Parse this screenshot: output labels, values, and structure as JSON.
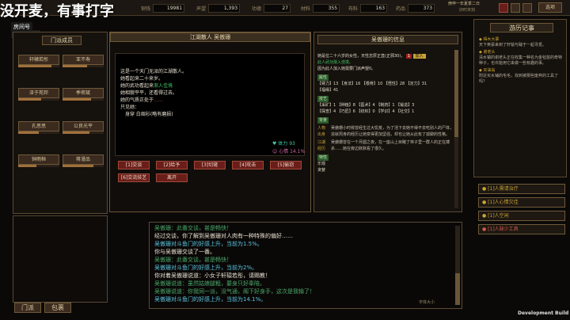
{
  "overlay": {
    "title": "没开麦，有事打字",
    "id_label": "房间号",
    "id_value": "1570959"
  },
  "topbar": {
    "stats": [
      {
        "label": "铜钱",
        "value": "19981"
      },
      {
        "label": "声望",
        "value": "1,393"
      },
      {
        "label": "功德",
        "value": "27"
      },
      {
        "label": "材料",
        "value": "355"
      },
      {
        "label": "布料",
        "value": "163"
      },
      {
        "label": "药品",
        "value": "373"
      }
    ],
    "date": "庚申一年夏季二日",
    "sub": "卯时末刻",
    "menu_label": "选项"
  },
  "left": {
    "header": "门派成员",
    "members": [
      {
        "name": "轩辕若彤",
        "bar": "80%"
      },
      {
        "name": "亚不寿",
        "bar": "60%"
      },
      {
        "name": "泽于苑邦",
        "bar": "55%"
      },
      {
        "name": "季密斌",
        "bar": "70%"
      },
      {
        "name": "孔思思",
        "bar": "50%"
      },
      {
        "name": "公良光平",
        "bar": "65%"
      },
      {
        "name": "钟雨桓",
        "bar": "45%"
      },
      {
        "name": "蒋漫品",
        "bar": "75%"
      }
    ],
    "bottom_labels": [
      "门派",
      "包裹"
    ]
  },
  "dialog": {
    "title": "江湖散人 吴傲珊",
    "lines": [
      {
        "text": "这是一个天门无派的江湖散人。",
        "color": "#e8e0d0"
      },
      {
        "text": "她看起来二十来岁。",
        "color": "#e8e0d0"
      },
      {
        "text": "她的武功看起来",
        "color": "#e8e0d0",
        "extra": "渐入佳境",
        "extra_color": "#46c66a"
      },
      {
        "text": "她相貌平平，还看得过去。",
        "color": "#e8e0d0"
      },
      {
        "text": "她的气质正处于",
        "color": "#e8e0d0",
        "extra": "……",
        "extra_color": "#c44a4a"
      },
      {
        "text": "只见她：",
        "color": "#e8e0d0"
      },
      {
        "text": "　身穿 白绸衫(略有磨损)",
        "color": "#e8e0d0"
      }
    ],
    "hp_label": "体力",
    "hp_value": "93",
    "mood_label": "心情",
    "mood_value": "14.1%",
    "actions": [
      "[1]交谈",
      "[2]给予",
      "[3]切磋",
      "[4]攻击",
      "[5]偷窃"
    ],
    "extra_action": "[6]交流技艺",
    "leave": "离开"
  },
  "info": {
    "title": "吴傲珊的信息",
    "desc": "她是位二十六岁的女性，天性志厚正直(正邪30)，",
    "desc2": "此人武功渐入佳境。",
    "desc3": "因为此人加入她需要门派声望0。",
    "badge": "1",
    "badge_btn": "加入",
    "sec1": "属性",
    "attr_row1": "【臂力】13 【身法】16 【根骨】10 【悟性】28 【定力】31",
    "attr_row2": "【福缘】41",
    "sec2": "技艺",
    "skill_row1": "【采矿】1 【种植】8 【医术】4 【制药】1 【锻造】3",
    "skill_row2": "【探查】4 【巧匠】6 【纺织】0 【学识】4 【社交】1",
    "sec3": "背景",
    "bg_label": "人物出身",
    "bg_text": "吴傲珊小时候曾经生过大饥荒，为了活下去她不得不去吃别人的尸体，造就周身的经历让她变得更加坚强，却也让她从此有了孤僻的性格。",
    "life_label": "江湖经历",
    "life_text": "吴傲珊曾在一个月圆之夜，在一座山上目睹了林子里一群人的正在搏杀……她在旁边默默看了很久。",
    "sec4": "特性",
    "trait1": "乐观",
    "trait2": "贪婪"
  },
  "right": {
    "header": "游历记事",
    "entries": [
      {
        "title": "◆ 得木大寨",
        "text": "天下英豪来到了轩辕与臻于一起寻觅。"
      },
      {
        "title": "◆ 谢老头",
        "text": "清水镇的谢老头正在收集一种名为金毡苗的奇特种子，也许能用它来做一些有趣的事。"
      },
      {
        "title": "◆ 买油翁",
        "text": "附近买水铺的毛毛，找到被那些废弃的工具了吗？"
      }
    ],
    "quests": [
      {
        "label": "[1]人需请治疗",
        "color": "#c9a437"
      },
      {
        "label": "[1]人心情欠佳",
        "color": "#c9a437"
      },
      {
        "label": "[1]人空闲",
        "color": "#c9a437"
      },
      {
        "label": "[1]人缺少工具",
        "color": "#b03a3a"
      }
    ]
  },
  "log": {
    "lines": [
      {
        "text": "吴傲珊：此番交谈，甚是畅快！",
        "color": "#4aa86a"
      },
      {
        "text": "经过交谈，你了解到吴傲珊对人肉有一种特殊的偏好……",
        "color": "#e8e0d0"
      },
      {
        "text": "吴傲珊对斗鱼门的好感上升，当前为1.5%。",
        "color": "#5ac4e0"
      },
      {
        "text": "你与吴傲珊交谈了一番。",
        "color": "#e8e0d0"
      },
      {
        "text": "吴傲珊：此番交谈，甚是畅快！",
        "color": "#4aa86a"
      },
      {
        "text": "吴傲珊对斗鱼门的好感上升，当前为2%。",
        "color": "#5ac4e0"
      },
      {
        "text": "你对着吴傲珊说道：小女子轩辕若彤，请赐教！",
        "color": "#e8e0d0"
      },
      {
        "text": "吴傲珊说道：虽然姑娘腿粗，要身只好奉陪。",
        "color": "#4aa86a"
      },
      {
        "text": "吴傲珊说道：你我同一派，没气通，阁下好身手，这次是我输了！",
        "color": "#4aa86a"
      },
      {
        "text": "吴傲珊对斗鱼门的好感上升，当前为14.1%。",
        "color": "#5ac4e0"
      }
    ],
    "speed": "字体大小"
  },
  "footer": {
    "dev": "Development Build"
  }
}
